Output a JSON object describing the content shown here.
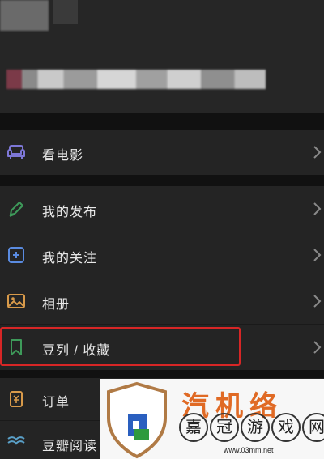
{
  "menu": {
    "items": [
      {
        "label": "看电影",
        "icon": "sofa-icon"
      },
      {
        "label": "我的发布",
        "icon": "pencil-icon"
      },
      {
        "label": "我的关注",
        "icon": "plus-box-icon"
      },
      {
        "label": "相册",
        "icon": "image-icon"
      },
      {
        "label": "豆列 / 收藏",
        "icon": "bookmark-icon"
      },
      {
        "label": "订单",
        "icon": "order-icon"
      },
      {
        "label": "豆瓣阅读",
        "icon": "book-icon"
      }
    ],
    "highlight_color": "#d72626"
  },
  "watermark": {
    "title": "汽机络",
    "chars": [
      "嘉",
      "冠",
      "游",
      "戏",
      "网"
    ],
    "url": "www.03mm.net"
  }
}
